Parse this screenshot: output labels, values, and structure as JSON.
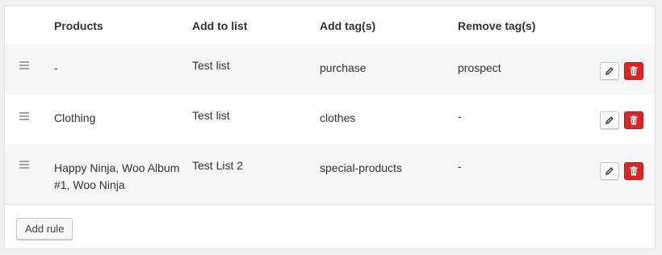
{
  "table": {
    "headers": {
      "products": "Products",
      "add_to_list": "Add to list",
      "add_tags": "Add tag(s)",
      "remove_tags": "Remove tag(s)"
    },
    "rows": [
      {
        "products": "-",
        "list": "Test list",
        "add_tags": "purchase",
        "remove_tags": "prospect"
      },
      {
        "products": "Clothing",
        "list": "Test list",
        "add_tags": "clothes",
        "remove_tags": "-"
      },
      {
        "products": "Happy Ninja, Woo Album #1, Woo Ninja",
        "list": "Test List 2",
        "add_tags": "special-products",
        "remove_tags": "-"
      }
    ]
  },
  "footer": {
    "add_rule_label": "Add rule"
  },
  "icons": {
    "drag": "drag-handle-icon",
    "edit": "pencil-icon",
    "delete": "trash-icon"
  },
  "colors": {
    "delete_button": "#dc2626",
    "alt_row_bg": "#f6f6f6"
  }
}
